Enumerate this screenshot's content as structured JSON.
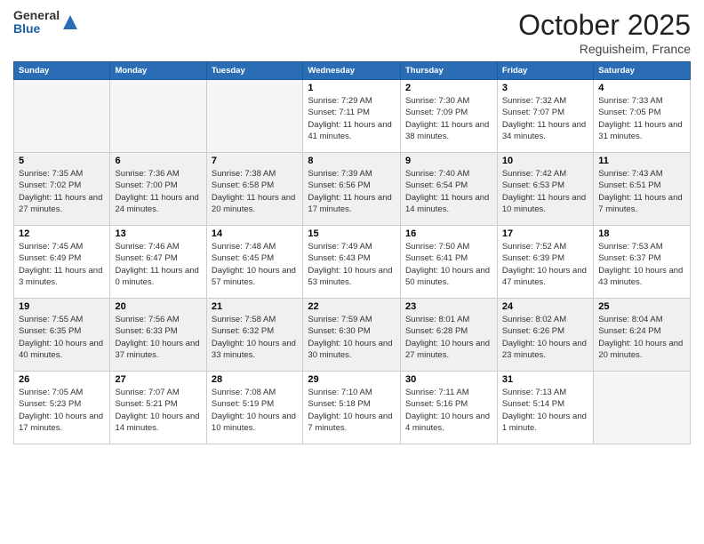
{
  "header": {
    "logo_general": "General",
    "logo_blue": "Blue",
    "month": "October 2025",
    "location": "Reguisheim, France"
  },
  "weekdays": [
    "Sunday",
    "Monday",
    "Tuesday",
    "Wednesday",
    "Thursday",
    "Friday",
    "Saturday"
  ],
  "weeks": [
    [
      {
        "day": "",
        "empty": true
      },
      {
        "day": "",
        "empty": true
      },
      {
        "day": "",
        "empty": true
      },
      {
        "day": "1",
        "sunrise": "Sunrise: 7:29 AM",
        "sunset": "Sunset: 7:11 PM",
        "daylight": "Daylight: 11 hours and 41 minutes."
      },
      {
        "day": "2",
        "sunrise": "Sunrise: 7:30 AM",
        "sunset": "Sunset: 7:09 PM",
        "daylight": "Daylight: 11 hours and 38 minutes."
      },
      {
        "day": "3",
        "sunrise": "Sunrise: 7:32 AM",
        "sunset": "Sunset: 7:07 PM",
        "daylight": "Daylight: 11 hours and 34 minutes."
      },
      {
        "day": "4",
        "sunrise": "Sunrise: 7:33 AM",
        "sunset": "Sunset: 7:05 PM",
        "daylight": "Daylight: 11 hours and 31 minutes."
      }
    ],
    [
      {
        "day": "5",
        "sunrise": "Sunrise: 7:35 AM",
        "sunset": "Sunset: 7:02 PM",
        "daylight": "Daylight: 11 hours and 27 minutes."
      },
      {
        "day": "6",
        "sunrise": "Sunrise: 7:36 AM",
        "sunset": "Sunset: 7:00 PM",
        "daylight": "Daylight: 11 hours and 24 minutes."
      },
      {
        "day": "7",
        "sunrise": "Sunrise: 7:38 AM",
        "sunset": "Sunset: 6:58 PM",
        "daylight": "Daylight: 11 hours and 20 minutes."
      },
      {
        "day": "8",
        "sunrise": "Sunrise: 7:39 AM",
        "sunset": "Sunset: 6:56 PM",
        "daylight": "Daylight: 11 hours and 17 minutes."
      },
      {
        "day": "9",
        "sunrise": "Sunrise: 7:40 AM",
        "sunset": "Sunset: 6:54 PM",
        "daylight": "Daylight: 11 hours and 14 minutes."
      },
      {
        "day": "10",
        "sunrise": "Sunrise: 7:42 AM",
        "sunset": "Sunset: 6:53 PM",
        "daylight": "Daylight: 11 hours and 10 minutes."
      },
      {
        "day": "11",
        "sunrise": "Sunrise: 7:43 AM",
        "sunset": "Sunset: 6:51 PM",
        "daylight": "Daylight: 11 hours and 7 minutes."
      }
    ],
    [
      {
        "day": "12",
        "sunrise": "Sunrise: 7:45 AM",
        "sunset": "Sunset: 6:49 PM",
        "daylight": "Daylight: 11 hours and 3 minutes."
      },
      {
        "day": "13",
        "sunrise": "Sunrise: 7:46 AM",
        "sunset": "Sunset: 6:47 PM",
        "daylight": "Daylight: 11 hours and 0 minutes."
      },
      {
        "day": "14",
        "sunrise": "Sunrise: 7:48 AM",
        "sunset": "Sunset: 6:45 PM",
        "daylight": "Daylight: 10 hours and 57 minutes."
      },
      {
        "day": "15",
        "sunrise": "Sunrise: 7:49 AM",
        "sunset": "Sunset: 6:43 PM",
        "daylight": "Daylight: 10 hours and 53 minutes."
      },
      {
        "day": "16",
        "sunrise": "Sunrise: 7:50 AM",
        "sunset": "Sunset: 6:41 PM",
        "daylight": "Daylight: 10 hours and 50 minutes."
      },
      {
        "day": "17",
        "sunrise": "Sunrise: 7:52 AM",
        "sunset": "Sunset: 6:39 PM",
        "daylight": "Daylight: 10 hours and 47 minutes."
      },
      {
        "day": "18",
        "sunrise": "Sunrise: 7:53 AM",
        "sunset": "Sunset: 6:37 PM",
        "daylight": "Daylight: 10 hours and 43 minutes."
      }
    ],
    [
      {
        "day": "19",
        "sunrise": "Sunrise: 7:55 AM",
        "sunset": "Sunset: 6:35 PM",
        "daylight": "Daylight: 10 hours and 40 minutes."
      },
      {
        "day": "20",
        "sunrise": "Sunrise: 7:56 AM",
        "sunset": "Sunset: 6:33 PM",
        "daylight": "Daylight: 10 hours and 37 minutes."
      },
      {
        "day": "21",
        "sunrise": "Sunrise: 7:58 AM",
        "sunset": "Sunset: 6:32 PM",
        "daylight": "Daylight: 10 hours and 33 minutes."
      },
      {
        "day": "22",
        "sunrise": "Sunrise: 7:59 AM",
        "sunset": "Sunset: 6:30 PM",
        "daylight": "Daylight: 10 hours and 30 minutes."
      },
      {
        "day": "23",
        "sunrise": "Sunrise: 8:01 AM",
        "sunset": "Sunset: 6:28 PM",
        "daylight": "Daylight: 10 hours and 27 minutes."
      },
      {
        "day": "24",
        "sunrise": "Sunrise: 8:02 AM",
        "sunset": "Sunset: 6:26 PM",
        "daylight": "Daylight: 10 hours and 23 minutes."
      },
      {
        "day": "25",
        "sunrise": "Sunrise: 8:04 AM",
        "sunset": "Sunset: 6:24 PM",
        "daylight": "Daylight: 10 hours and 20 minutes."
      }
    ],
    [
      {
        "day": "26",
        "sunrise": "Sunrise: 7:05 AM",
        "sunset": "Sunset: 5:23 PM",
        "daylight": "Daylight: 10 hours and 17 minutes."
      },
      {
        "day": "27",
        "sunrise": "Sunrise: 7:07 AM",
        "sunset": "Sunset: 5:21 PM",
        "daylight": "Daylight: 10 hours and 14 minutes."
      },
      {
        "day": "28",
        "sunrise": "Sunrise: 7:08 AM",
        "sunset": "Sunset: 5:19 PM",
        "daylight": "Daylight: 10 hours and 10 minutes."
      },
      {
        "day": "29",
        "sunrise": "Sunrise: 7:10 AM",
        "sunset": "Sunset: 5:18 PM",
        "daylight": "Daylight: 10 hours and 7 minutes."
      },
      {
        "day": "30",
        "sunrise": "Sunrise: 7:11 AM",
        "sunset": "Sunset: 5:16 PM",
        "daylight": "Daylight: 10 hours and 4 minutes."
      },
      {
        "day": "31",
        "sunrise": "Sunrise: 7:13 AM",
        "sunset": "Sunset: 5:14 PM",
        "daylight": "Daylight: 10 hours and 1 minute."
      },
      {
        "day": "",
        "empty": true
      }
    ]
  ]
}
